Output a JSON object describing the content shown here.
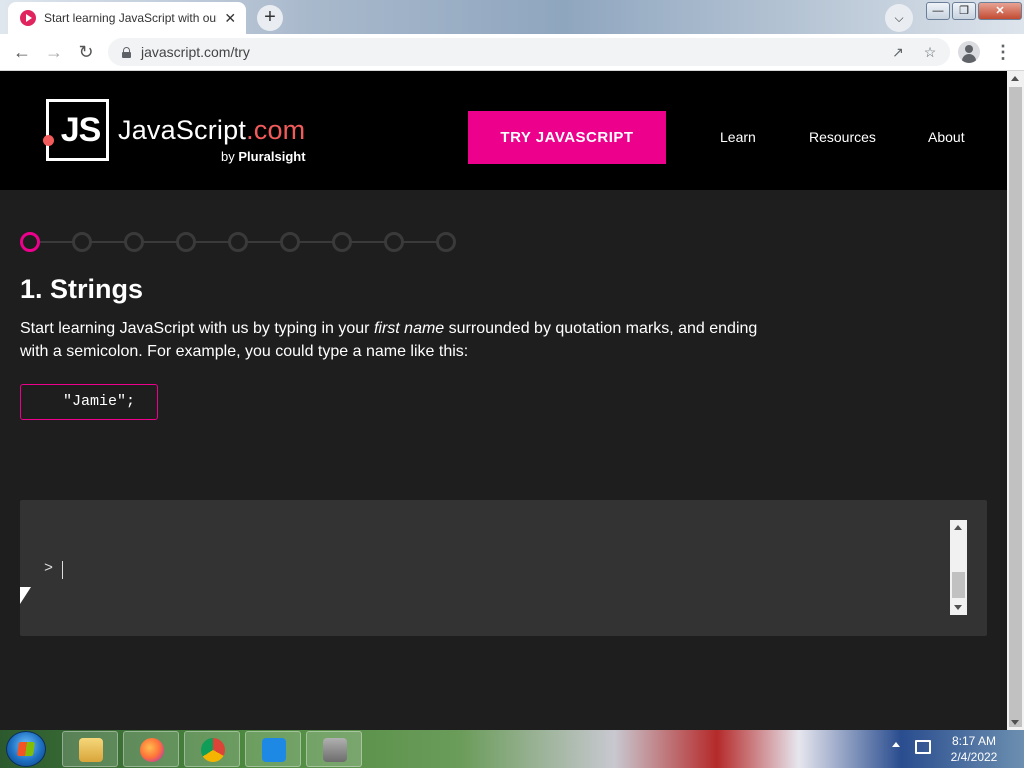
{
  "browser": {
    "tab_title": "Start learning JavaScript with our",
    "tab_close": "✕",
    "new_tab": "+",
    "url": "javascript.com/try",
    "window_controls": {
      "minimize": "—",
      "restore": "❐",
      "close": "✕"
    }
  },
  "site": {
    "logo_js": "JS",
    "logo_word": "JavaScript",
    "logo_dotcom": ".com",
    "logo_by": "by",
    "logo_brand": "Pluralsight",
    "try_button": "TRY JAVASCRIPT",
    "nav": {
      "learn": "Learn",
      "resources": "Resources",
      "about": "About"
    }
  },
  "lesson": {
    "step_count": 9,
    "current_step": 1,
    "title": "1. Strings",
    "text_before": "Start learning JavaScript with us by typing in your ",
    "text_emphasis": "first name",
    "text_after": " surrounded by quotation marks, and ending with a semicolon. For example, you could type a name like this:",
    "example_code": "\"Jamie\";"
  },
  "console": {
    "prompt": ">"
  },
  "taskbar": {
    "time": "8:17 AM",
    "date": "2/4/2022",
    "apps": [
      "file-explorer",
      "firefox",
      "chrome",
      "visual-studio-code",
      "package-installer"
    ]
  }
}
